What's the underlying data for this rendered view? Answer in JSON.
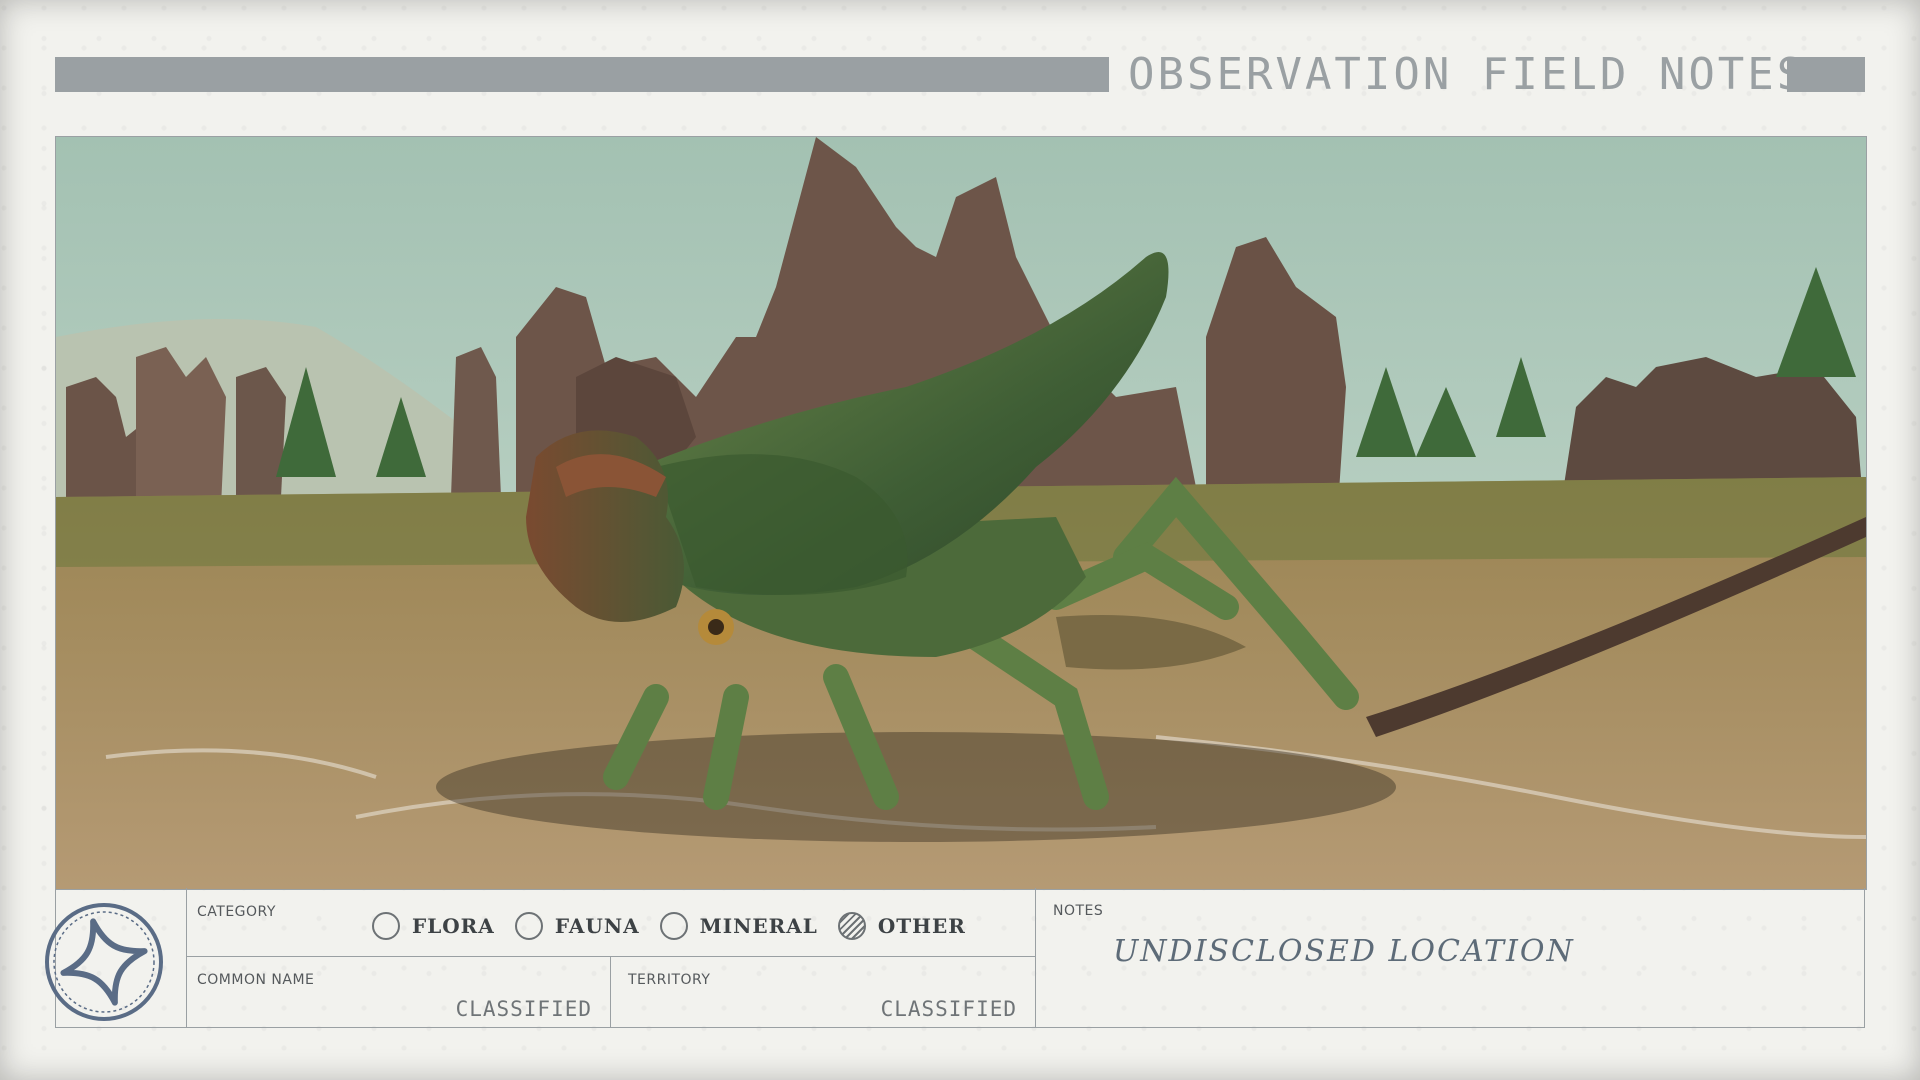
{
  "header": {
    "title": "OBSERVATION FIELD NOTES"
  },
  "photo": {
    "subject": "alien beetle-like creature on rocky plain",
    "colors": {
      "sky": "#a9c6b6",
      "ground": "#a8875a",
      "rock": "#6a5448",
      "shell": "#4e6a3a"
    }
  },
  "form": {
    "category_label": "CATEGORY",
    "options": [
      {
        "label": "FLORA",
        "checked": false
      },
      {
        "label": "FAUNA",
        "checked": false
      },
      {
        "label": "MINERAL",
        "checked": false
      },
      {
        "label": "OTHER",
        "checked": true
      }
    ],
    "common_name_label": "COMMON NAME",
    "common_name_value": "CLASSIFIED",
    "territory_label": "TERRITORY",
    "territory_value": "CLASSIFIED",
    "notes_label": "NOTES",
    "notes_value": "UNDISCLOSED LOCATION"
  },
  "logo": {
    "icon": "star-emblem-icon"
  }
}
